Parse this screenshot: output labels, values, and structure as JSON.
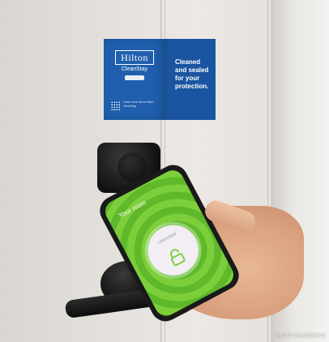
{
  "sign": {
    "brand": "Hilton",
    "program": "CleanStay",
    "message": "Cleaned and sealed for your protection.",
    "fine_print": "Learn more about Hilton CleanStay"
  },
  "phone": {
    "screen_title": "Your room",
    "button_label": "Unlocked"
  },
  "caption": "PHOTO RENDERING",
  "colors": {
    "sign_blue": "#1f5fae",
    "screen_green": "#7ccf3a"
  },
  "icons": [
    "lock-icon"
  ]
}
